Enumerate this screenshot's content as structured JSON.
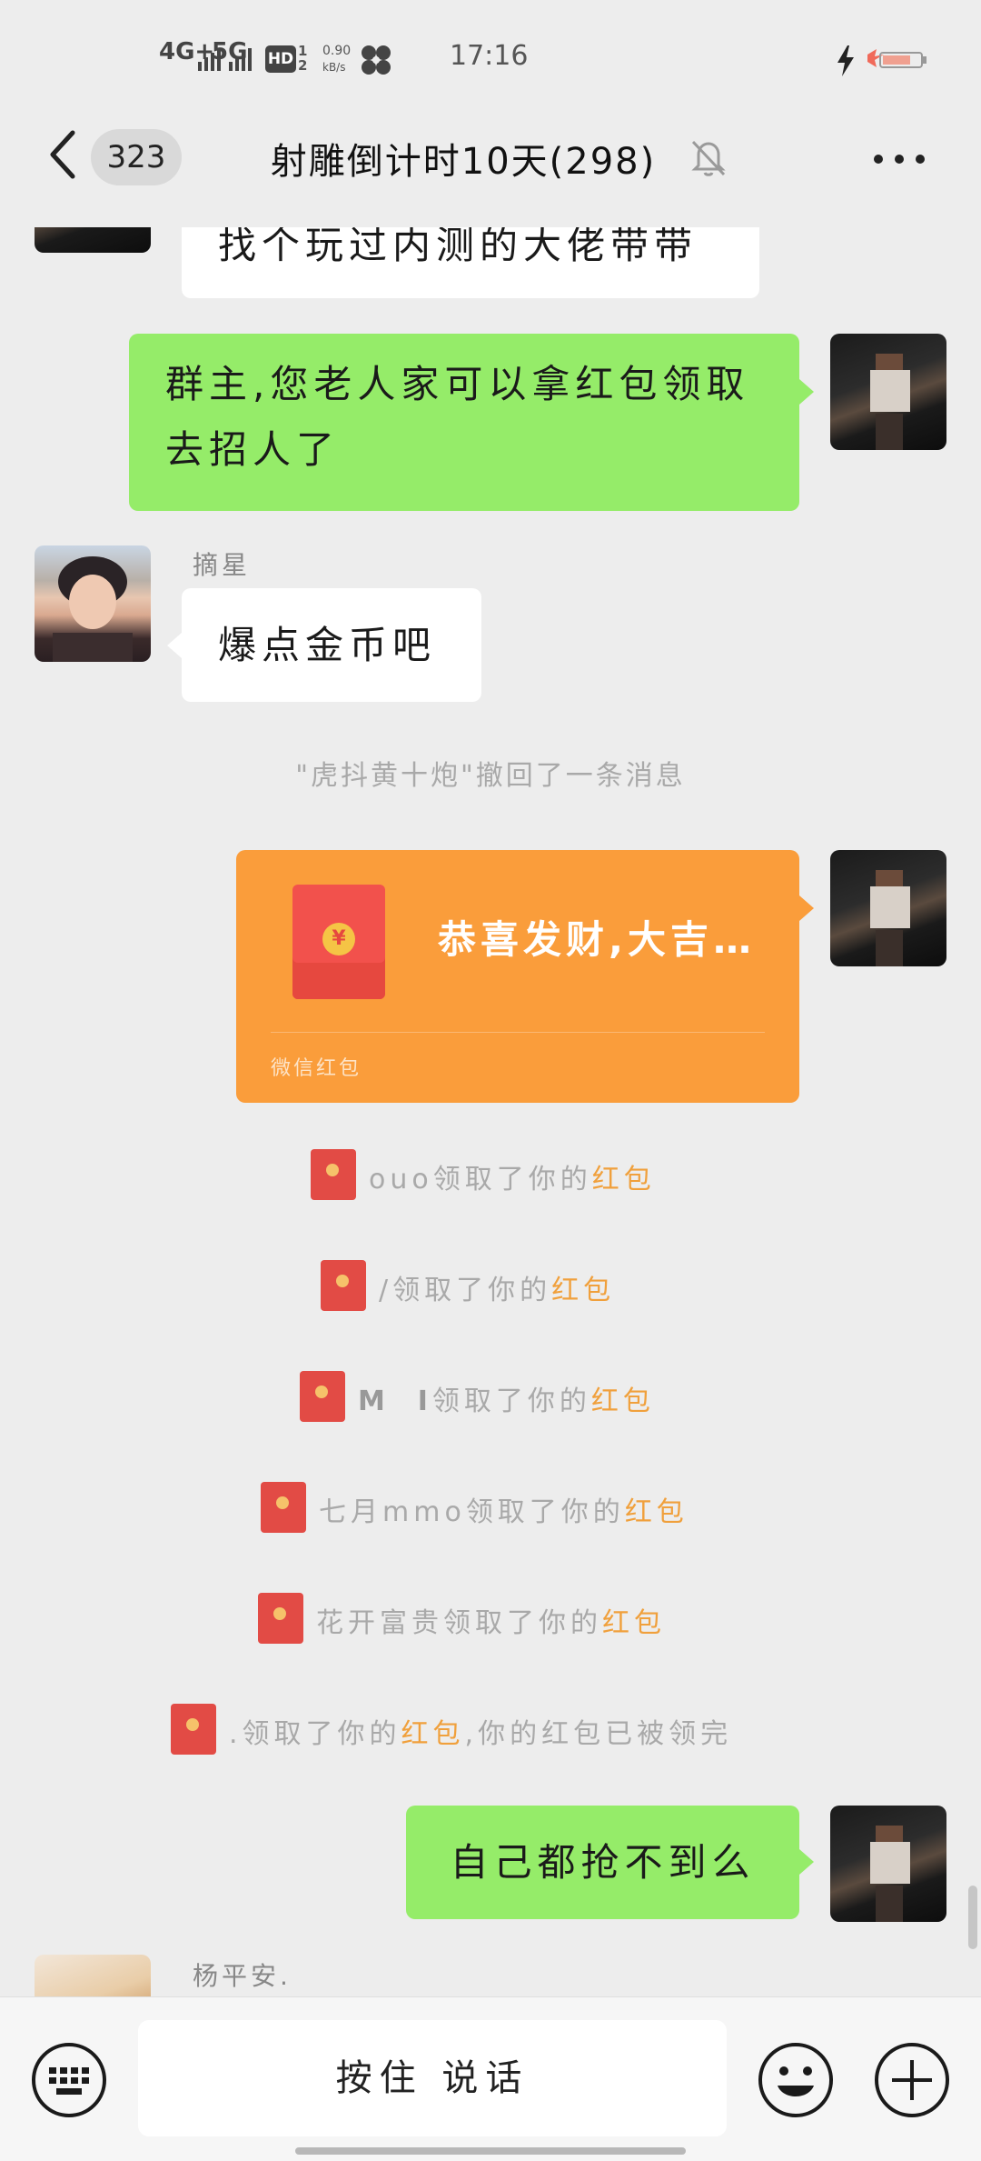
{
  "status_bar": {
    "network1": "4G+",
    "network2": "5G",
    "hd_label": "HD",
    "hd_sub1": "1",
    "hd_sub2": "2",
    "speed_value": "0.90",
    "speed_unit": "kB/s",
    "time": "17:16"
  },
  "header": {
    "unread_count": "323",
    "title": "射雕倒计时10天(298)"
  },
  "messages": {
    "partial_top_text": "找个玩过内测的大佬带带",
    "m1_text": "群主,您老人家可以拿红包领取去招人了",
    "m2_sender": "摘星",
    "m2_text": "爆点金币吧",
    "sys_recall": "\"虎抖黄十炮\"撤回了一条消息",
    "redpacket_title": "恭喜发财,大吉…",
    "redpacket_footer": "微信红包",
    "redpacket_coin": "¥",
    "m4_text": "自己都抢不到么",
    "m5_sender": "杨平安."
  },
  "claims": [
    {
      "name": "ouo",
      "mid": "领取了你的",
      "link": "红包",
      "suffix": ""
    },
    {
      "name": "/",
      "mid": "领取了你的",
      "link": "红包",
      "suffix": ""
    },
    {
      "name": "M  I",
      "mid": "领取了你的",
      "link": "红包",
      "suffix": ""
    },
    {
      "name": "七月mmo",
      "mid": "领取了你的",
      "link": "红包",
      "suffix": ""
    },
    {
      "name": "花开富贵",
      "mid": "领取了你的",
      "link": "红包",
      "suffix": ""
    },
    {
      "name": ".",
      "mid": "领取了你的",
      "link": "红包",
      "suffix": ",你的红包已被领完"
    }
  ],
  "input": {
    "hold_to_talk": "按住 说话"
  },
  "colors": {
    "background": "#ededed",
    "green_bubble": "#95ec69",
    "red_packet": "#fa9d3b",
    "link_orange": "#f0a03c"
  },
  "icons": [
    "back-arrow-icon",
    "mute-bell-icon",
    "more-dots-icon",
    "keyboard-icon",
    "emoji-icon",
    "plus-icon",
    "red-envelope-icon"
  ]
}
